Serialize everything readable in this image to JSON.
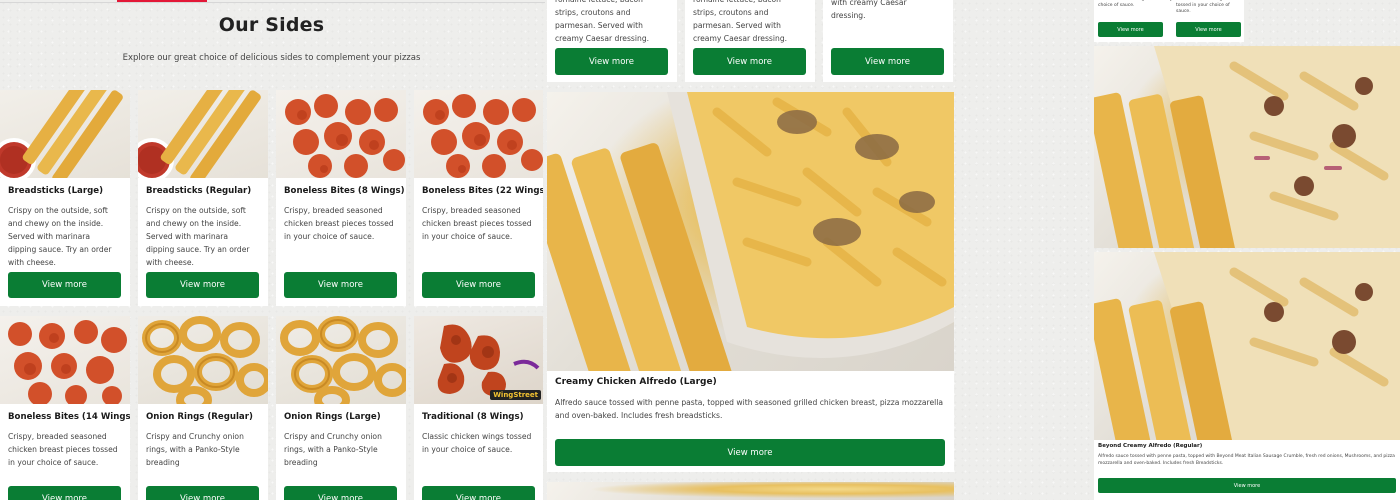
{
  "header": {
    "title": "Our Sides",
    "subtitle": "Explore our great choice of delicious sides to complement your pizzas"
  },
  "colors": {
    "accent_red": "#e31837",
    "button_green": "#0a7d34"
  },
  "grid_items": [
    {
      "name": "Breadsticks (Large)",
      "description": "Crispy on the outside, soft and chewy on the inside. Served with marinara dipping sauce. Try an order with cheese.",
      "button": "View more",
      "image": "breadsticks-image"
    },
    {
      "name": "Breadsticks (Regular)",
      "description": "Crispy on the outside, soft and chewy on the inside. Served with marinara dipping sauce. Try an order with cheese.",
      "button": "View more",
      "image": "breadsticks-image"
    },
    {
      "name": "Boneless Bites (8 Wings)",
      "description": "Crispy, breaded seasoned chicken breast pieces tossed in your choice of sauce.",
      "button": "View more",
      "image": "boneless-bites-image"
    },
    {
      "name": "Boneless Bites (22 Wings)",
      "description": "Crispy, breaded seasoned chicken breast pieces tossed in your choice of sauce.",
      "button": "View more",
      "image": "boneless-bites-image"
    },
    {
      "name": "Boneless Bites (14 Wings)",
      "description": "Crispy, breaded seasoned chicken breast pieces tossed in your choice of sauce.",
      "button": "View more",
      "image": "boneless-bites-image"
    },
    {
      "name": "Onion Rings (Regular)",
      "description": "Crispy and Crunchy onion rings, with a Panko-Style breading",
      "button": "View more",
      "image": "onion-rings-image"
    },
    {
      "name": "Onion Rings (Large)",
      "description": "Crispy and Crunchy onion rings, with a Panko-Style breading",
      "button": "View more",
      "image": "onion-rings-image"
    },
    {
      "name": "Traditional (8 Wings)",
      "description": "Classic chicken wings tossed in your choice of sauce.",
      "button": "View more",
      "image": "traditional-wings-image",
      "badge": "WingStreet"
    }
  ],
  "middle_top": [
    {
      "description": "romaine lettuce, bacon strips, croutons and parmesan. Served with creamy Caesar dressing.",
      "button": "View more"
    },
    {
      "description": "romaine lettuce, bacon strips, croutons and parmesan. Served with creamy Caesar dressing.",
      "button": "View more"
    },
    {
      "description": "with creamy Caesar dressing.",
      "button": "View more"
    }
  ],
  "featured": {
    "name": "Creamy Chicken Alfredo (Large)",
    "description": "Alfredo sauce tossed with penne pasta, topped with seasoned grilled chicken breast, pizza mozzarella and oven-baked. Includes fresh breadsticks.",
    "button": "View more"
  },
  "right_column": {
    "top_cards": [
      {
        "description": "Classic chicken wings tossed in your choice of sauce.",
        "button": "View more"
      },
      {
        "description": "Classic chicken wings tossed in your choice of sauce.",
        "button": "View more"
      }
    ],
    "bottom_card": {
      "name": "Beyond Creamy Alfredo (Regular)",
      "description": "Alfredo sauce tossed with penne pasta, topped with Beyond Meat Italian Sausage Crumble, fresh red onions, Mushrooms, and pizza mozzarella and oven-baked. Includes fresh Breadsticks.",
      "button": "View more"
    }
  }
}
